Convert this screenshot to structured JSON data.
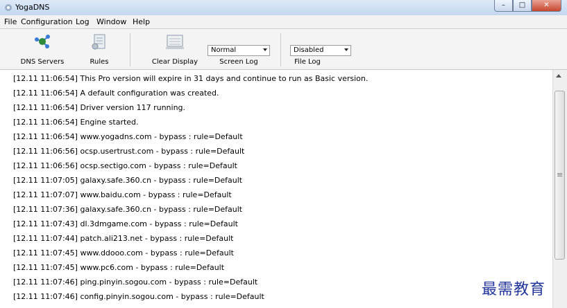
{
  "window": {
    "title": "YogaDNS",
    "controls": {
      "minimize": "–",
      "maximize": "□",
      "close": "✕"
    }
  },
  "menu": [
    "File",
    "Configuration",
    "Log",
    "Window",
    "Help"
  ],
  "toolbar": {
    "dns_servers_label": "DNS Servers",
    "rules_label": "Rules",
    "clear_display_label": "Clear Display",
    "screen_log": {
      "value": "Normal",
      "label": "Screen Log"
    },
    "file_log": {
      "value": "Disabled",
      "label": "File Log"
    }
  },
  "log_lines": [
    "[12.11 11:06:54] This Pro version will expire in 31 days and continue to run as Basic version.",
    "[12.11 11:06:54] A default configuration was created.",
    "[12.11 11:06:54] Driver version 117 running.",
    "[12.11 11:06:54] Engine started.",
    "[12.11 11:06:54] www.yogadns.com - bypass : rule=Default",
    "[12.11 11:06:56] ocsp.usertrust.com - bypass : rule=Default",
    "[12.11 11:06:56] ocsp.sectigo.com - bypass : rule=Default",
    "[12.11 11:07:05] galaxy.safe.360.cn - bypass : rule=Default",
    "[12.11 11:07:07] www.baidu.com - bypass : rule=Default",
    "[12.11 11:07:36] galaxy.safe.360.cn - bypass : rule=Default",
    "[12.11 11:07:43] dl.3dmgame.com - bypass : rule=Default",
    "[12.11 11:07:44] patch.ali213.net - bypass : rule=Default",
    "[12.11 11:07:45] www.ddooo.com - bypass : rule=Default",
    "[12.11 11:07:45] www.pc6.com - bypass : rule=Default",
    "[12.11 11:07:46] ping.pinyin.sogou.com - bypass : rule=Default",
    "[12.11 11:07:46] config.pinyin.sogou.com - bypass : rule=Default"
  ],
  "watermark": "最需教育",
  "icons": {
    "app": "yogadns-app-icon",
    "dns_servers": "network-nodes-icon",
    "rules": "rules-list-icon",
    "clear_display": "clear-display-icon"
  },
  "colors": {
    "title_bar": "#c3d7ef",
    "close_button": "#c7452e",
    "watermark": "#23379b"
  }
}
